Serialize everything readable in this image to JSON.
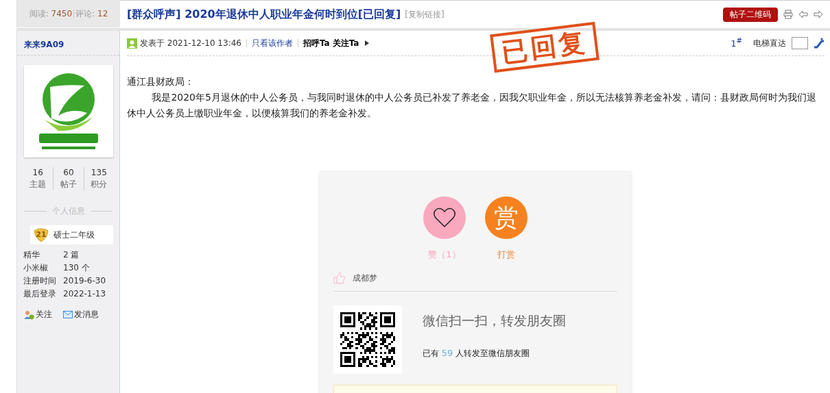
{
  "stats_bar": {
    "reads_label": "阅读:",
    "reads": "7450",
    "comments_label": "评论:",
    "comments": "12"
  },
  "thread": {
    "title": "[群众呼声] 2020年退休中人职业年金何时到位[已回复]",
    "copy_link": "[复制链接]",
    "qr_button": "帖子二维码"
  },
  "author": {
    "name": "来来9A09",
    "stats": [
      {
        "value": "16",
        "label": "主题"
      },
      {
        "value": "60",
        "label": "帖子"
      },
      {
        "value": "135",
        "label": "积分"
      }
    ],
    "section_title": "个人信息",
    "level": "21",
    "rank": "硕士二年级",
    "info": [
      {
        "label": "精华",
        "value": "2 篇"
      },
      {
        "label": "小米椒",
        "value": "130 个"
      },
      {
        "label": "注册时间",
        "value": "2019-6-30"
      },
      {
        "label": "最后登录",
        "value": "2022-1-13"
      }
    ],
    "actions": [
      {
        "kind": "follow",
        "label": "关注"
      },
      {
        "kind": "message",
        "label": "发消息"
      }
    ]
  },
  "post": {
    "posted": "发表于 2021-12-10 13:46",
    "author_only": "只看该作者",
    "greet": "招呼Ta",
    "follow": "关注Ta",
    "floor": "1",
    "floor_mark": "#",
    "jump_label": "电梯直达",
    "stamp": "已回复",
    "greeting": "通江县财政局：",
    "body": "我是2020年5月退休的中人公务员，与我同时退休的中人公务员已补发了养老金，因我欠职业年金，所以无法核算养老金补发，请问：县财政局何时为我们退休中人公务员上缴职业年金，以便核算我们的养老金补发。"
  },
  "reward_card": {
    "buttons": [
      {
        "kind": "like",
        "label": "赞（1）"
      },
      {
        "kind": "reward",
        "glyph": "赏",
        "label": "打赏"
      }
    ],
    "likers": [
      "成都梦"
    ],
    "share_title": "微信扫一扫，转发朋友圈",
    "share_prefix": "已有",
    "share_count": "59",
    "share_suffix": "人转发至微信朋友圈"
  }
}
